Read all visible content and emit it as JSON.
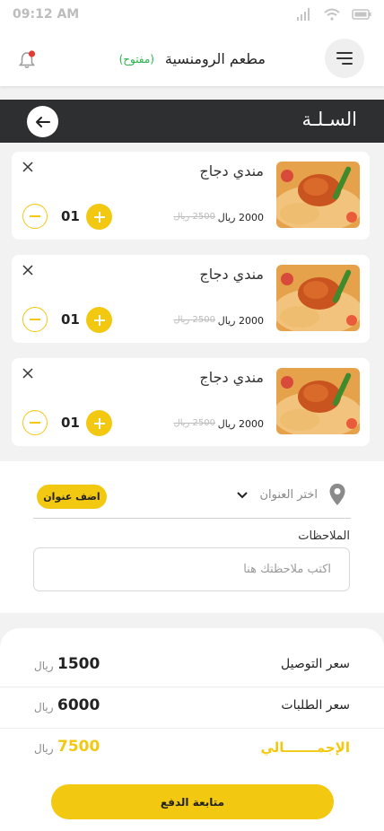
{
  "status_bar": {
    "time": "09:12 AM"
  },
  "header": {
    "restaurant_name": "مطعم الرومنسية",
    "status": "(مفتوح)"
  },
  "page": {
    "title": "السـلـة"
  },
  "cart": {
    "items": [
      {
        "name": "مندي دجاج",
        "price": "2000 ريال",
        "old_price": "2500 ريال",
        "quantity": "01"
      },
      {
        "name": "مندي دجاج",
        "price": "2000 ريال",
        "old_price": "2500 ريال",
        "quantity": "01"
      },
      {
        "name": "مندي دجاج",
        "price": "2000 ريال",
        "old_price": "2500 ريال",
        "quantity": "01"
      }
    ]
  },
  "address": {
    "select_label": "اختر العنوان",
    "add_button": "اضف عنوان"
  },
  "notes": {
    "label": "الملاحظات",
    "placeholder": "اكتب ملاحظتك هنا",
    "value": ""
  },
  "summary": {
    "delivery": {
      "label": "سعر التوصيل",
      "value": "1500",
      "currency": "ريال"
    },
    "orders": {
      "label": "سعر الطلبات",
      "value": "6000",
      "currency": "ريال"
    },
    "total": {
      "label": "الإجمـــــــالي",
      "value": "7500",
      "currency": "ريال"
    }
  },
  "checkout_button": "متابعة الدفع",
  "colors": {
    "accent": "#f2c811",
    "open_status": "#2bb24c",
    "titlebar": "#2d2f31"
  }
}
